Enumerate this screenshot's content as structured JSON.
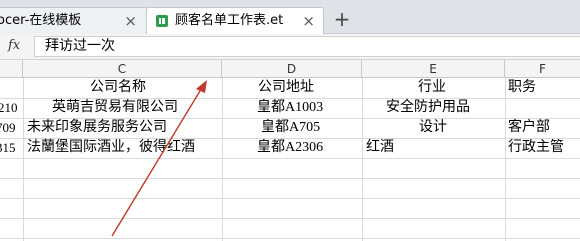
{
  "tabs": [
    {
      "label": "ocer-在线模板",
      "close": "×"
    },
    {
      "label": "顾客名单工作表.et",
      "close": "×"
    }
  ],
  "new_tab_label": "+",
  "formula_bar": {
    "fx_label": "fx",
    "value": "拜访过一次"
  },
  "columns": [
    "C",
    "D",
    "E",
    "F"
  ],
  "rows": [
    {
      "rownum": "",
      "company": "公司名称",
      "address": "公司地址",
      "industry": "行业",
      "title": "职务"
    },
    {
      "rownum": "210",
      "company": "英萌吉贸易有限公司",
      "address": "皇都A1003",
      "industry": "安全防护用品",
      "title": ""
    },
    {
      "rownum": "709",
      "company": "未来印象展务服务公司",
      "address": "皇都A705",
      "industry": "设计",
      "title": "客户部"
    },
    {
      "rownum": "315",
      "company": "法蘭堡国际酒业，彼得红酒",
      "address": "皇都A2306",
      "industry": "红酒",
      "title": "行政主管"
    }
  ],
  "colors": {
    "annotation_arrow": "#c0392b",
    "tab_bar": "#dfe3e8",
    "header_bg": "#f4f4f4"
  }
}
